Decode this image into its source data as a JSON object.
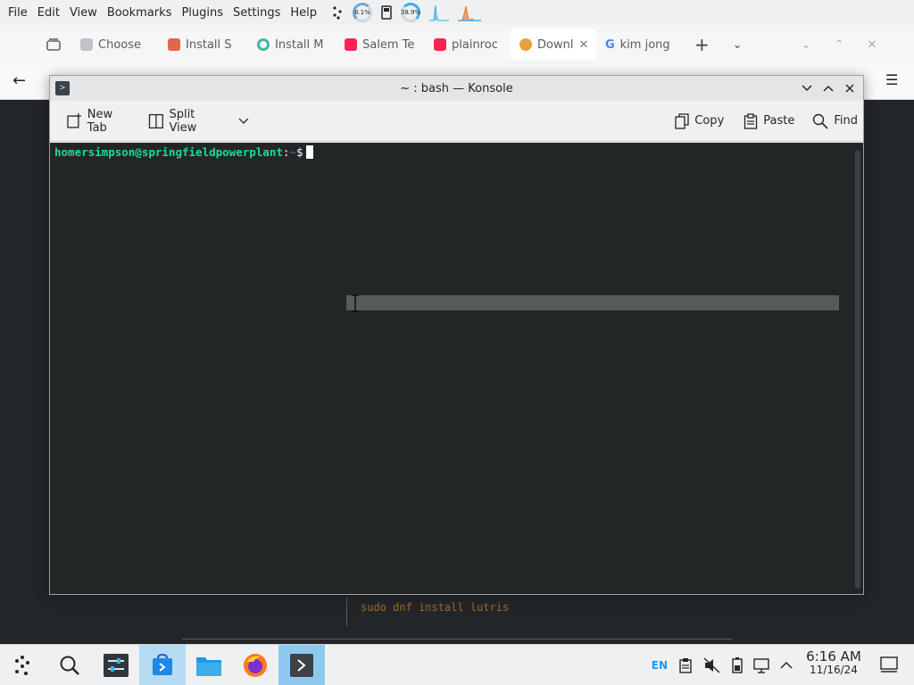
{
  "menubar": {
    "items": [
      "File",
      "Edit",
      "View",
      "Bookmarks",
      "Plugins",
      "Settings",
      "Help"
    ],
    "cpu_label": "8.1%",
    "mem_label": "38.9%"
  },
  "browser": {
    "tabs": [
      {
        "label": "Choose",
        "icon": "cube-favicon",
        "color": "#8a8f94"
      },
      {
        "label": "Install S",
        "icon": "arrow-favicon",
        "color": "#e0684b"
      },
      {
        "label": "Install M",
        "icon": "ring-favicon",
        "color": "#48b4a0"
      },
      {
        "label": "Salem Te",
        "icon": "youtube-favicon",
        "color": "#ff2255"
      },
      {
        "label": "plainroc",
        "icon": "youtube-favicon",
        "color": "#ff2255"
      },
      {
        "label": "Downl",
        "icon": "firefox-favicon",
        "color": "#e6a040"
      },
      {
        "label": "kim jong",
        "icon": "google-favicon",
        "color": "#4285f4"
      }
    ],
    "background_command": "sudo dnf install lutris"
  },
  "konsole": {
    "title": "~ : bash — Konsole",
    "toolbar": {
      "new_tab": "New Tab",
      "split_view": "Split View",
      "copy": "Copy",
      "paste": "Paste",
      "find": "Find"
    },
    "prompt": {
      "user_host": "homersimpson@springfieldpowerplant",
      "colon": ":",
      "path": "~",
      "symbol": "$"
    }
  },
  "taskbar": {
    "language": "EN",
    "time": "6:16 AM",
    "date": "11/16/24"
  }
}
